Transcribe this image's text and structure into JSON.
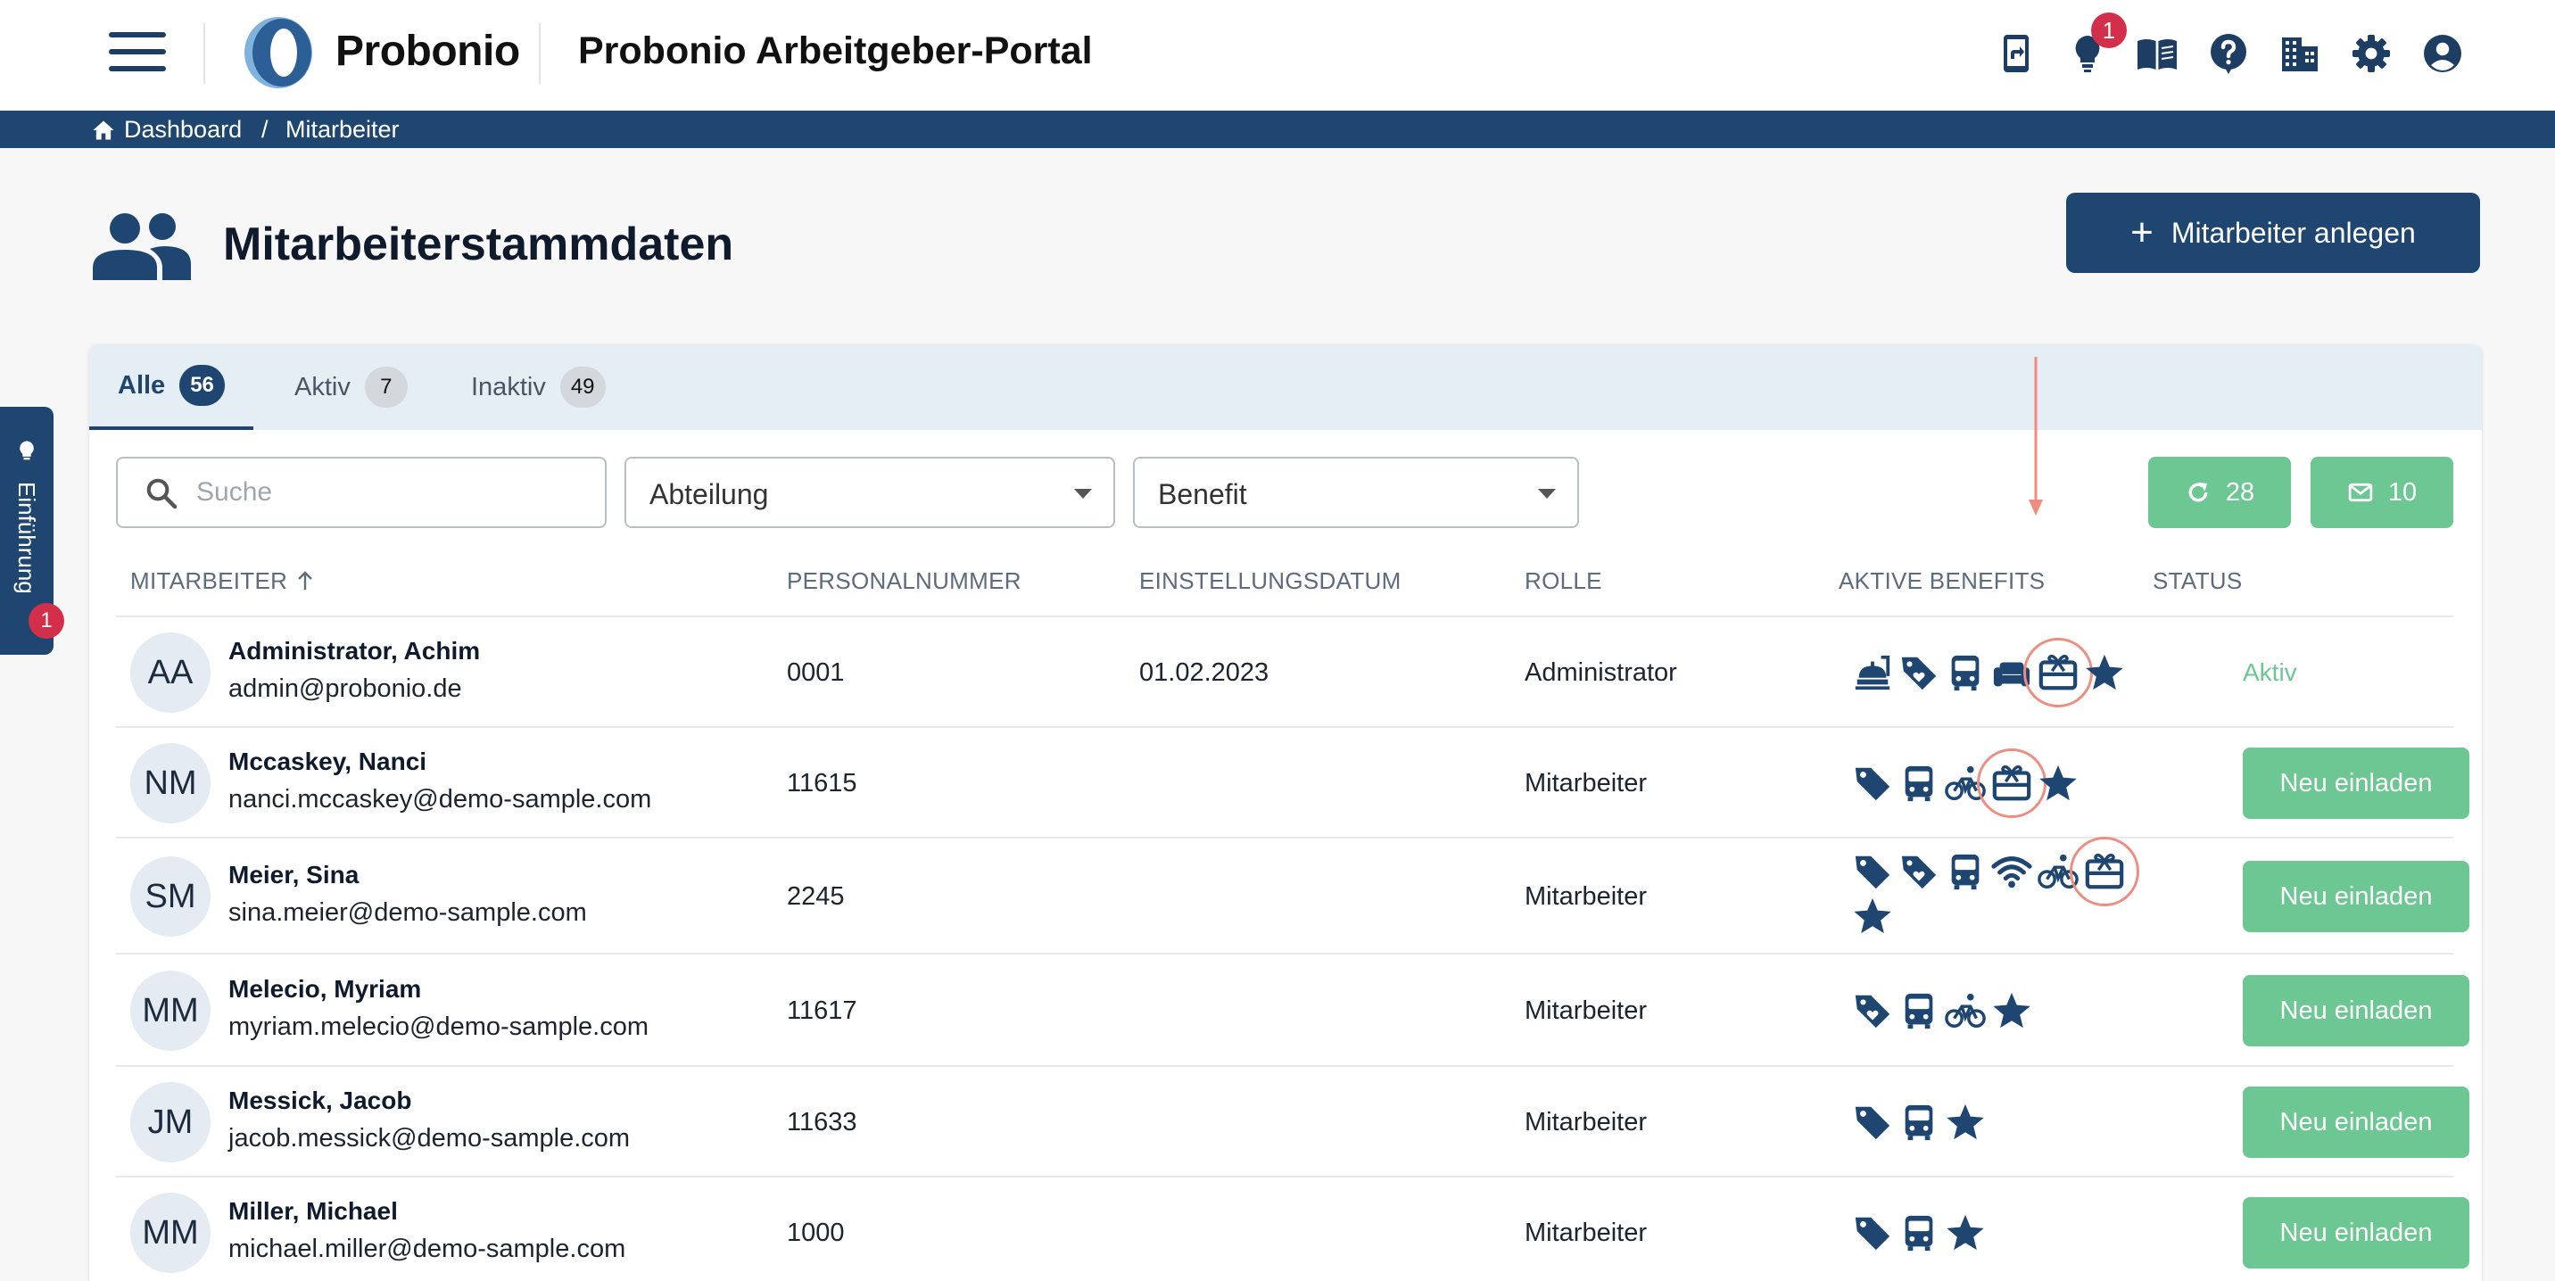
{
  "header": {
    "logo_text": "Probonio",
    "portal_title": "Probonio Arbeitgeber-Portal",
    "notification_count": "1",
    "icons": [
      "mobile-share-icon",
      "lightbulb-icon",
      "book-icon",
      "help-icon",
      "company-icon",
      "settings-icon",
      "account-icon"
    ]
  },
  "breadcrumb": {
    "home": "Dashboard",
    "separator": "/",
    "current": "Mitarbeiter"
  },
  "page": {
    "title": "Mitarbeiterstammdaten",
    "add_button": "Mitarbeiter anlegen"
  },
  "side_tab": {
    "label": "Einführung",
    "badge": "1"
  },
  "tabs": [
    {
      "label": "Alle",
      "count": "56",
      "active": true
    },
    {
      "label": "Aktiv",
      "count": "7",
      "active": false
    },
    {
      "label": "Inaktiv",
      "count": "49",
      "active": false
    }
  ],
  "filters": {
    "search_placeholder": "Suche",
    "department": "Abteilung",
    "benefit": "Benefit"
  },
  "actions": {
    "refresh_count": "28",
    "mail_count": "10"
  },
  "table": {
    "columns": {
      "employee": "MITARBEITER",
      "personnel_number": "PERSONALNUMMER",
      "hire_date": "EINSTELLUNGSDATUM",
      "role": "ROLLE",
      "benefits": "AKTIVE BENEFITS",
      "status": "STATUS"
    },
    "rows": [
      {
        "initials": "AA",
        "name": "Administrator, Achim",
        "email": "admin@probonio.de",
        "number": "0001",
        "hire_date": "01.02.2023",
        "role": "Administrator",
        "status": "Aktiv",
        "benefits": [
          "lunch-icon",
          "voucher-icon",
          "bus-icon",
          "couch-icon",
          "gift-card-icon",
          "star-icon"
        ],
        "highlighted_benefit": "gift-card-icon"
      },
      {
        "initials": "NM",
        "name": "Mccaskey, Nanci",
        "email": "nanci.mccaskey@demo-sample.com",
        "number": "11615",
        "hire_date": "",
        "role": "Mitarbeiter",
        "status": "Neu einladen",
        "benefits": [
          "tag-icon",
          "bus-icon",
          "bike-icon",
          "gift-card-icon",
          "star-icon"
        ],
        "highlighted_benefit": "gift-card-icon"
      },
      {
        "initials": "SM",
        "name": "Meier, Sina",
        "email": "sina.meier@demo-sample.com",
        "number": "2245",
        "hire_date": "",
        "role": "Mitarbeiter",
        "status": "Neu einladen",
        "benefits": [
          "tag-icon",
          "voucher-icon",
          "bus-icon",
          "wifi-icon",
          "bike-icon",
          "gift-card-icon",
          "star-icon"
        ],
        "highlighted_benefit": "gift-card-icon"
      },
      {
        "initials": "MM",
        "name": "Melecio, Myriam",
        "email": "myriam.melecio@demo-sample.com",
        "number": "11617",
        "hire_date": "",
        "role": "Mitarbeiter",
        "status": "Neu einladen",
        "benefits": [
          "voucher-icon",
          "bus-icon",
          "bike-icon",
          "star-icon"
        ]
      },
      {
        "initials": "JM",
        "name": "Messick, Jacob",
        "email": "jacob.messick@demo-sample.com",
        "number": "11633",
        "hire_date": "",
        "role": "Mitarbeiter",
        "status": "Neu einladen",
        "benefits": [
          "tag-icon",
          "bus-icon",
          "star-icon"
        ]
      },
      {
        "initials": "MM",
        "name": "Miller, Michael",
        "email": "michael.miller@demo-sample.com",
        "number": "1000",
        "hire_date": "",
        "role": "Mitarbeiter",
        "status": "Neu einladen",
        "benefits": [
          "tag-icon",
          "bus-icon",
          "star-icon"
        ]
      }
    ]
  },
  "colors": {
    "navy": "#1e4670",
    "green": "#6cc792",
    "badge_red": "#d32f4a",
    "annotation": "#ee8d80"
  }
}
